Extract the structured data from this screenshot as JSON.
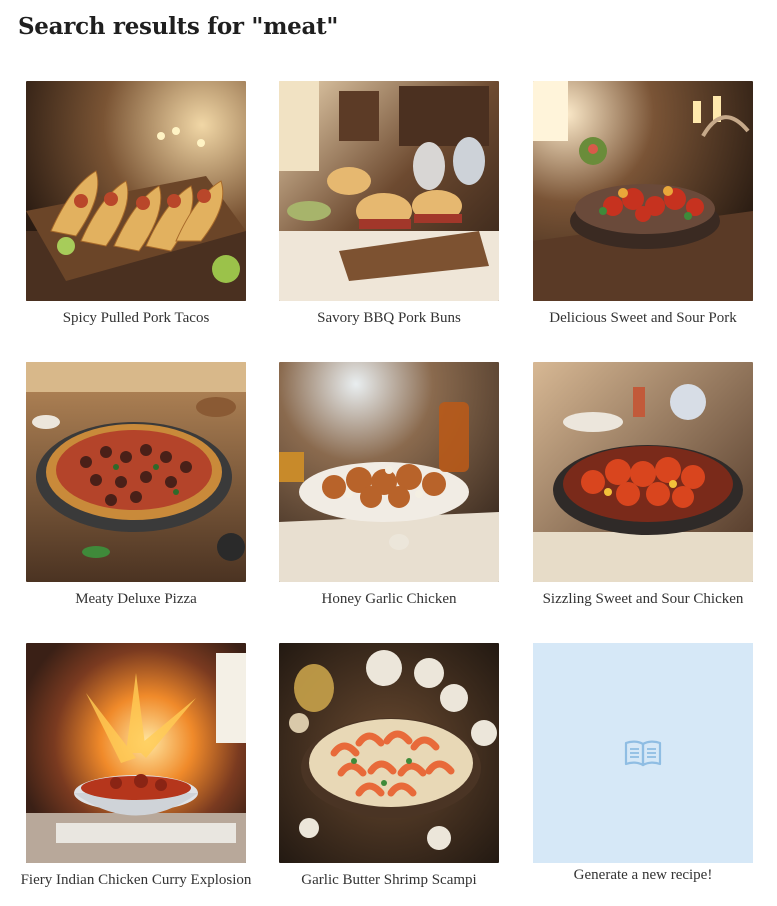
{
  "page": {
    "title": "Search results for \"meat\""
  },
  "recipes": [
    {
      "title": "Spicy Pulled Pork Tacos",
      "image": "tacos-on-board-photo"
    },
    {
      "title": "Savory BBQ Pork Buns",
      "image": "pork-buns-photo"
    },
    {
      "title": "Delicious Sweet and Sour Pork",
      "image": "sweet-sour-pork-photo"
    },
    {
      "title": "Meaty Deluxe Pizza",
      "image": "pizza-photo"
    },
    {
      "title": "Honey Garlic Chicken",
      "image": "honey-garlic-chicken-photo"
    },
    {
      "title": "Sizzling Sweet and Sour Chicken",
      "image": "sweet-sour-chicken-photo"
    },
    {
      "title": "Fiery Indian Chicken Curry Explosion",
      "image": "curry-explosion-photo"
    },
    {
      "title": "Garlic Butter Shrimp Scampi",
      "image": "shrimp-scampi-photo"
    }
  ],
  "generate": {
    "label": "Generate a new recipe!",
    "icon": "open-book-icon",
    "tile_color": "#d6e8f7",
    "icon_color": "#8fbde3"
  }
}
